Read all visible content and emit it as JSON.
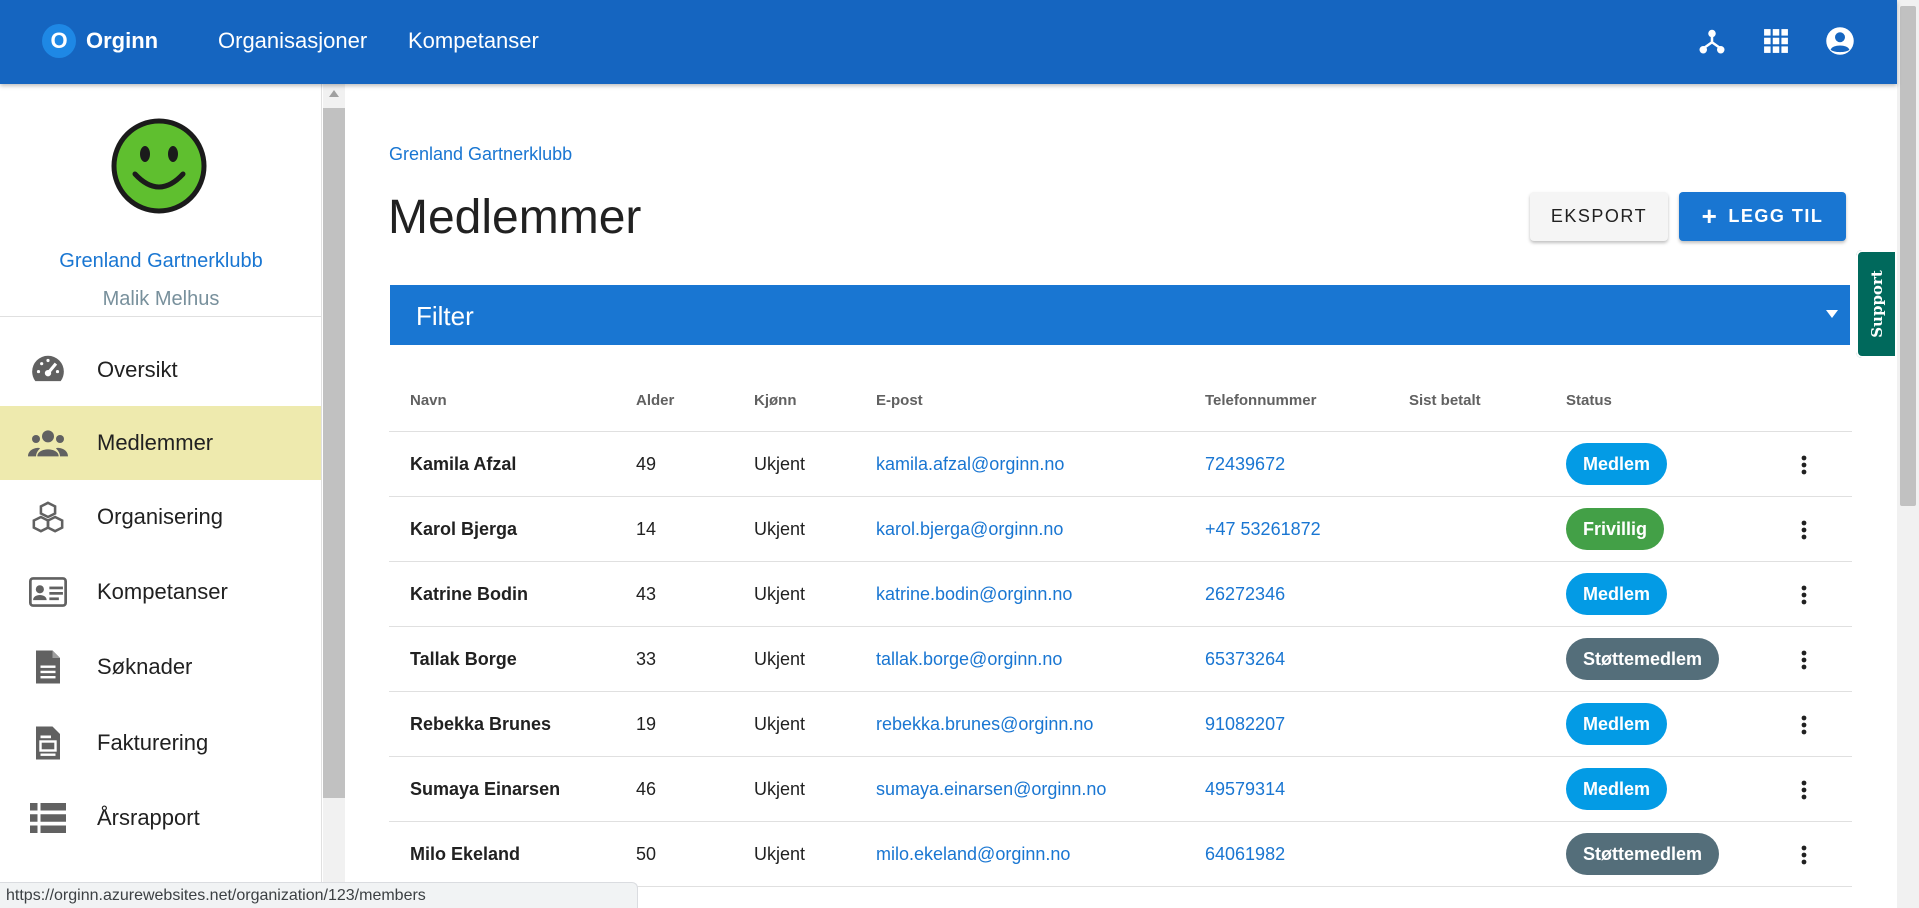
{
  "appbar": {
    "brand_letter": "O",
    "brand_name": "Orginn",
    "nav": [
      "Organisasjoner",
      "Kompetanser"
    ],
    "icons": [
      "hierarchy-icon",
      "apps-grid-icon",
      "account-circle-icon"
    ]
  },
  "sidebar": {
    "org_name": "Grenland Gartnerklubb",
    "user_name": "Malik Melhus",
    "items": [
      {
        "label": "Oversikt",
        "icon": "speedometer-icon",
        "active": false
      },
      {
        "label": "Medlemmer",
        "icon": "people-icon",
        "active": true
      },
      {
        "label": "Organisering",
        "icon": "cubes-icon",
        "active": false
      },
      {
        "label": "Kompetanser",
        "icon": "id-card-icon",
        "active": false
      },
      {
        "label": "Søknader",
        "icon": "document-icon",
        "active": false
      },
      {
        "label": "Fakturering",
        "icon": "invoice-icon",
        "active": false
      },
      {
        "label": "Årsrapport",
        "icon": "list-icon",
        "active": false
      }
    ]
  },
  "main": {
    "breadcrumb": "Grenland Gartnerklubb",
    "title": "Medlemmer",
    "export_label": "EKSPORT",
    "add_label": "LEGG TIL",
    "filter_label": "Filter",
    "support_label": "Support"
  },
  "table": {
    "columns": [
      "Navn",
      "Alder",
      "Kjønn",
      "E-post",
      "Telefonnummer",
      "Sist betalt",
      "Status"
    ],
    "rows": [
      {
        "name": "Kamila Afzal",
        "age": "49",
        "gender": "Ukjent",
        "email": "kamila.afzal@orginn.no",
        "phone": "72439672",
        "last_paid": "",
        "status": "Medlem"
      },
      {
        "name": "Karol Bjerga",
        "age": "14",
        "gender": "Ukjent",
        "email": "karol.bjerga@orginn.no",
        "phone": "+47 53261872",
        "last_paid": "",
        "status": "Frivillig"
      },
      {
        "name": "Katrine Bodin",
        "age": "43",
        "gender": "Ukjent",
        "email": "katrine.bodin@orginn.no",
        "phone": "26272346",
        "last_paid": "",
        "status": "Medlem"
      },
      {
        "name": "Tallak Borge",
        "age": "33",
        "gender": "Ukjent",
        "email": "tallak.borge@orginn.no",
        "phone": "65373264",
        "last_paid": "",
        "status": "Støttemedlem"
      },
      {
        "name": "Rebekka Brunes",
        "age": "19",
        "gender": "Ukjent",
        "email": "rebekka.brunes@orginn.no",
        "phone": "91082207",
        "last_paid": "",
        "status": "Medlem"
      },
      {
        "name": "Sumaya Einarsen",
        "age": "46",
        "gender": "Ukjent",
        "email": "sumaya.einarsen@orginn.no",
        "phone": "49579314",
        "last_paid": "",
        "status": "Medlem"
      },
      {
        "name": "Milo Ekeland",
        "age": "50",
        "gender": "Ukjent",
        "email": "milo.ekeland@orginn.no",
        "phone": "64061982",
        "last_paid": "",
        "status": "Støttemedlem"
      }
    ]
  },
  "status_colors": {
    "Medlem": "#039be5",
    "Frivillig": "#43a047",
    "Støttemedlem": "#546e7a"
  },
  "statusbar": {
    "url": "https://orginn.azurewebsites.net/organization/123/members"
  }
}
